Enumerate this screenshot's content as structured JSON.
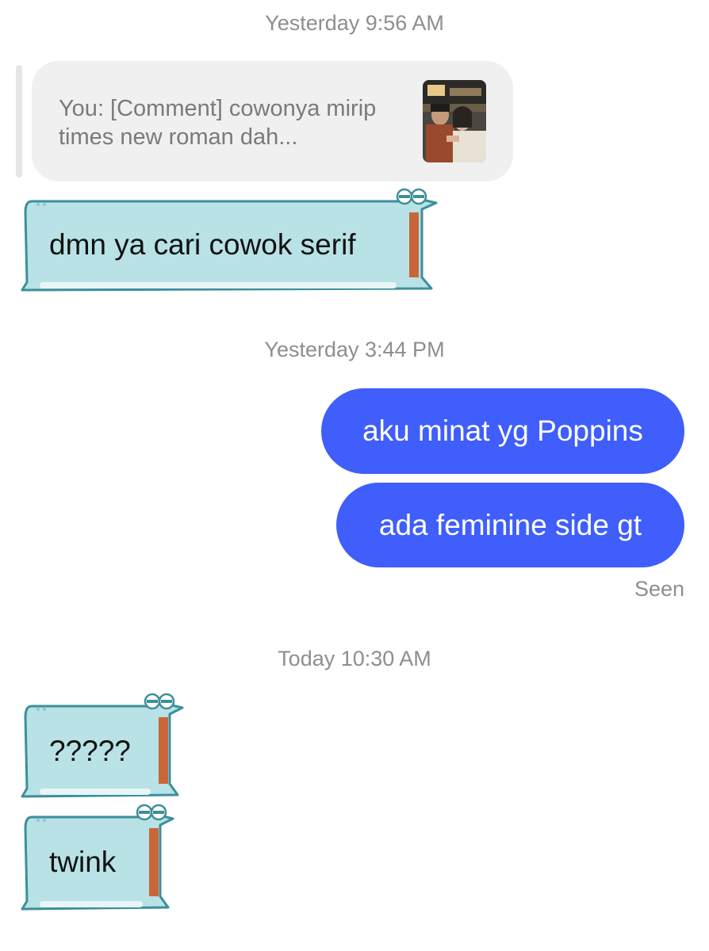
{
  "timestamps": {
    "first": "Yesterday 9:56 AM",
    "second": "Yesterday 3:44 PM",
    "third": "Today 10:30 AM"
  },
  "reply_preview": {
    "text": "You: [Comment] cowonya mirip times new roman dah...",
    "thumbnail_icon": "photo-thumbnail"
  },
  "messages": [
    {
      "direction": "incoming",
      "style": "crocodile-sticker",
      "text": "dmn ya cari cowok serif"
    },
    {
      "direction": "outgoing",
      "text": "aku minat yg Poppins"
    },
    {
      "direction": "outgoing",
      "text": "ada feminine side gt"
    },
    {
      "direction": "incoming",
      "style": "crocodile-sticker",
      "text": "?????"
    },
    {
      "direction": "incoming",
      "style": "crocodile-sticker",
      "text": "twink"
    }
  ],
  "status": {
    "seen": "Seen"
  },
  "colors": {
    "outgoing_bubble": "#3f5efb",
    "croc_body": "#b8e2e6",
    "croc_outline": "#3c8f9b",
    "croc_mouth": "#c8663a",
    "timestamp_text": "#8e8e8e"
  }
}
